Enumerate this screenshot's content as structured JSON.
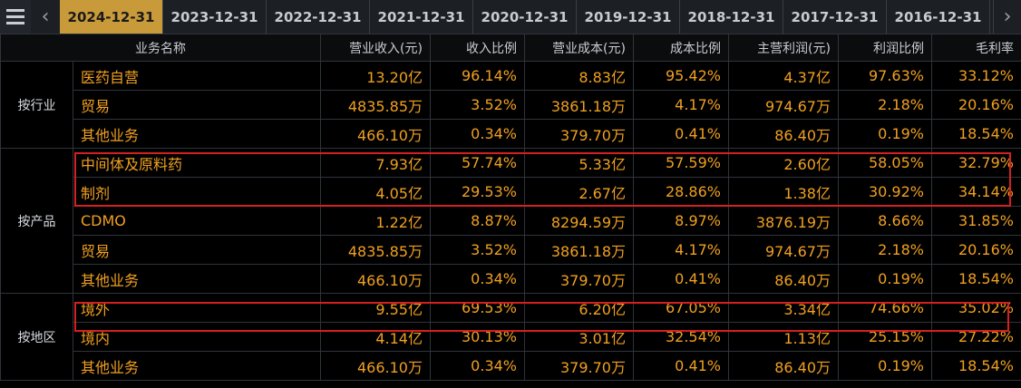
{
  "tabs": [
    "2024-12-31",
    "2023-12-31",
    "2022-12-31",
    "2021-12-31",
    "2020-12-31",
    "2019-12-31",
    "2018-12-31",
    "2017-12-31",
    "2016-12-31"
  ],
  "active_tab": 0,
  "headers": {
    "name": "业务名称",
    "revenue": "营业收入(元)",
    "revenue_ratio": "收入比例",
    "cost": "营业成本(元)",
    "cost_ratio": "成本比例",
    "profit": "主营利润(元)",
    "profit_ratio": "利润比例",
    "gross_margin": "毛利率"
  },
  "groups": {
    "industry": "按行业",
    "product": "按产品",
    "region": "按地区"
  },
  "rows": [
    {
      "name": "医药自营",
      "revenue": "13.20亿",
      "revenue_ratio": "96.14%",
      "cost": "8.83亿",
      "cost_ratio": "95.42%",
      "profit": "4.37亿",
      "profit_ratio": "97.63%",
      "gross_margin": "33.12%"
    },
    {
      "name": "贸易",
      "revenue": "4835.85万",
      "revenue_ratio": "3.52%",
      "cost": "3861.18万",
      "cost_ratio": "4.17%",
      "profit": "974.67万",
      "profit_ratio": "2.18%",
      "gross_margin": "20.16%"
    },
    {
      "name": "其他业务",
      "revenue": "466.10万",
      "revenue_ratio": "0.34%",
      "cost": "379.70万",
      "cost_ratio": "0.41%",
      "profit": "86.40万",
      "profit_ratio": "0.19%",
      "gross_margin": "18.54%"
    },
    {
      "name": "中间体及原料药",
      "revenue": "7.93亿",
      "revenue_ratio": "57.74%",
      "cost": "5.33亿",
      "cost_ratio": "57.59%",
      "profit": "2.60亿",
      "profit_ratio": "58.05%",
      "gross_margin": "32.79%"
    },
    {
      "name": "制剂",
      "revenue": "4.05亿",
      "revenue_ratio": "29.53%",
      "cost": "2.67亿",
      "cost_ratio": "28.86%",
      "profit": "1.38亿",
      "profit_ratio": "30.92%",
      "gross_margin": "34.14%"
    },
    {
      "name": "CDMO",
      "revenue": "1.22亿",
      "revenue_ratio": "8.87%",
      "cost": "8294.59万",
      "cost_ratio": "8.97%",
      "profit": "3876.19万",
      "profit_ratio": "8.66%",
      "gross_margin": "31.85%"
    },
    {
      "name": "贸易",
      "revenue": "4835.85万",
      "revenue_ratio": "3.52%",
      "cost": "3861.18万",
      "cost_ratio": "4.17%",
      "profit": "974.67万",
      "profit_ratio": "2.18%",
      "gross_margin": "20.16%"
    },
    {
      "name": "其他业务",
      "revenue": "466.10万",
      "revenue_ratio": "0.34%",
      "cost": "379.70万",
      "cost_ratio": "0.41%",
      "profit": "86.40万",
      "profit_ratio": "0.19%",
      "gross_margin": "18.54%"
    },
    {
      "name": "境外",
      "revenue": "9.55亿",
      "revenue_ratio": "69.53%",
      "cost": "6.20亿",
      "cost_ratio": "67.05%",
      "profit": "3.34亿",
      "profit_ratio": "74.66%",
      "gross_margin": "35.02%"
    },
    {
      "name": "境内",
      "revenue": "4.14亿",
      "revenue_ratio": "30.13%",
      "cost": "3.01亿",
      "cost_ratio": "32.54%",
      "profit": "1.13亿",
      "profit_ratio": "25.15%",
      "gross_margin": "27.22%"
    },
    {
      "name": "其他业务",
      "revenue": "466.10万",
      "revenue_ratio": "0.34%",
      "cost": "379.70万",
      "cost_ratio": "0.41%",
      "profit": "86.40万",
      "profit_ratio": "0.19%",
      "gross_margin": "18.54%"
    }
  ]
}
